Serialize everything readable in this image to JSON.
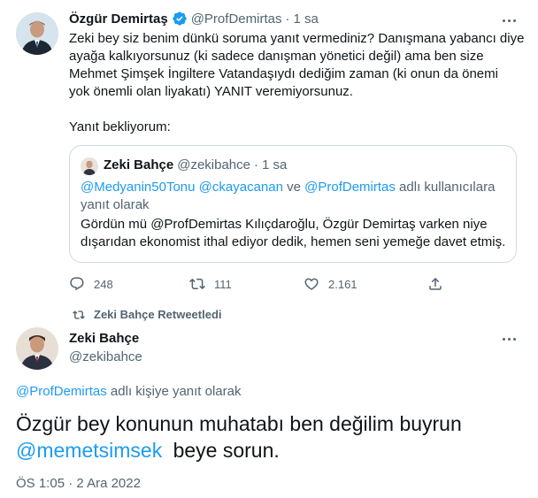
{
  "tweet": {
    "author_name": "Özgür Demirtaş",
    "handle": "@ProfDemirtas",
    "separator": "·",
    "time": "1 sa",
    "text_lines": [
      "Zeki bey siz benim dünkü soruma yanıt vermediniz? Danışmana yabancı diye",
      "ayağa kalkıyorsunuz (ki sadece danışman yönetici değil) ama ben size",
      "Mehmet Şimşek İngiltere Vatandaşıydı dediğim zaman (ki onun da önemi",
      "yok önemli olan liyakatı) YANIT veremiyorsunuz."
    ],
    "text_last": "Yanıt bekliyorum:",
    "quote": {
      "author_name": "Zeki Bahçe",
      "handle": "@zekibahce",
      "separator": "·",
      "time": "1 sa",
      "reply_prefix_mention1": "@Medyanin50Tonu",
      "reply_prefix_mention2": "@ckayacanan",
      "reply_prefix_and": "ve",
      "reply_prefix_mention3": "@ProfDemirtas",
      "reply_prefix_suffix": "adlı kullanıcılara",
      "reply_prefix_line2": "yanıt olarak",
      "body_line1_a": "Gördün mü @ProfDemirtas  Kılıçdaroğlu, Özgür Demirtaş varken niye",
      "body_line2": "dışarıdan ekonomist ithal ediyor dedik, hemen seni yemeğe davet etmiş."
    },
    "actions": {
      "replies": "248",
      "retweets": "111",
      "likes": "2.161"
    }
  },
  "retweet_banner": "Zeki Bahçe Retweetledi",
  "main_tweet": {
    "author_name": "Zeki Bahçe",
    "handle": "@zekibahce",
    "reply_mention": "@ProfDemirtas",
    "reply_suffix": "adlı kişiye yanıt olarak",
    "text_line1": "Özgür bey konunun muhatabı ben değilim buyrun",
    "text_mention": "@memetsimsek",
    "text_line2_rest": "beye sorun.",
    "timestamp": "ÖS 1:05",
    "date": "2 Ara 2022"
  },
  "colors": {
    "accent": "#1d9bf0",
    "muted": "#536471",
    "border": "#cfd9de",
    "text": "#0f1419"
  }
}
